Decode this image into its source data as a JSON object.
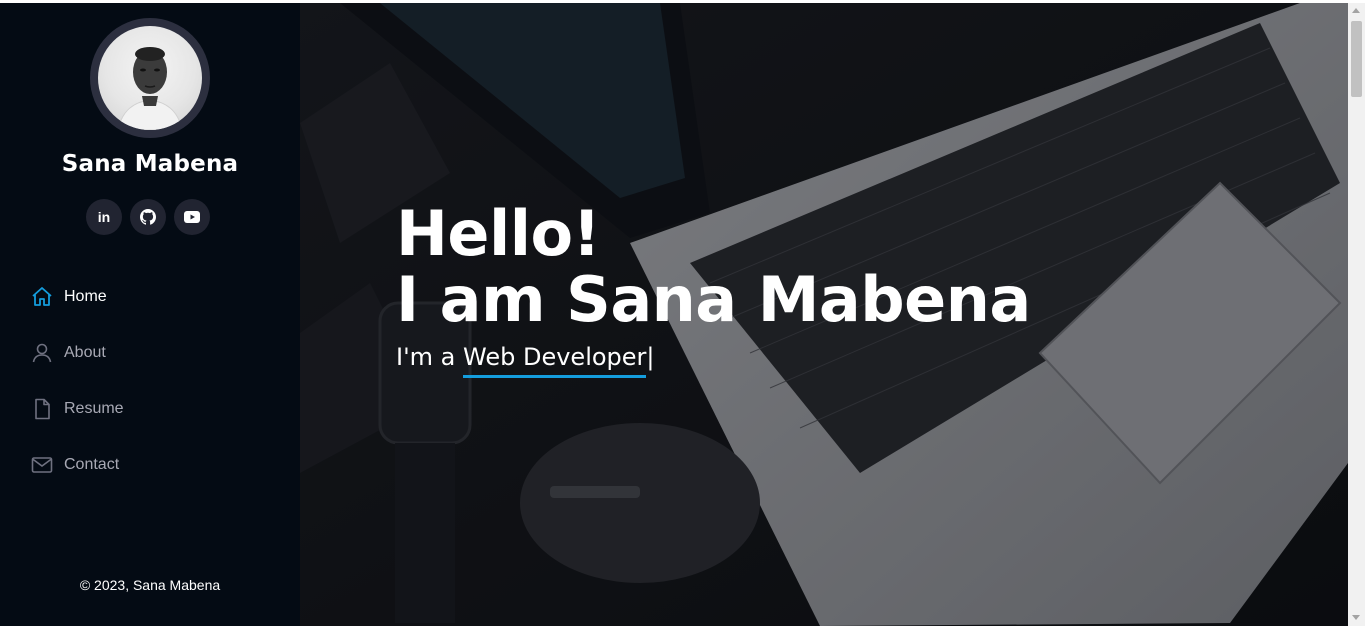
{
  "profile": {
    "name": "Sana Mabena",
    "avatar_icon": "person-photo"
  },
  "socials": [
    {
      "label": "in",
      "icon": "linkedin-icon"
    },
    {
      "label": "",
      "icon": "github-icon"
    },
    {
      "label": "",
      "icon": "youtube-icon"
    }
  ],
  "nav": {
    "items": [
      {
        "label": "Home",
        "icon": "home-icon",
        "active": true
      },
      {
        "label": "About",
        "icon": "person-icon",
        "active": false
      },
      {
        "label": "Resume",
        "icon": "file-icon",
        "active": false
      },
      {
        "label": "Contact",
        "icon": "envelope-icon",
        "active": false
      }
    ]
  },
  "footer": {
    "copyright": "© 2023, Sana Mabena"
  },
  "hero": {
    "line1": "Hello!",
    "line2": "I am Sana Mabena",
    "sub_prefix": "I'm a ",
    "typed": "Web Developer",
    "cursor": "|"
  },
  "colors": {
    "sidebar_bg": "#040b14",
    "accent": "#149ddd",
    "social_bg": "#212431"
  }
}
